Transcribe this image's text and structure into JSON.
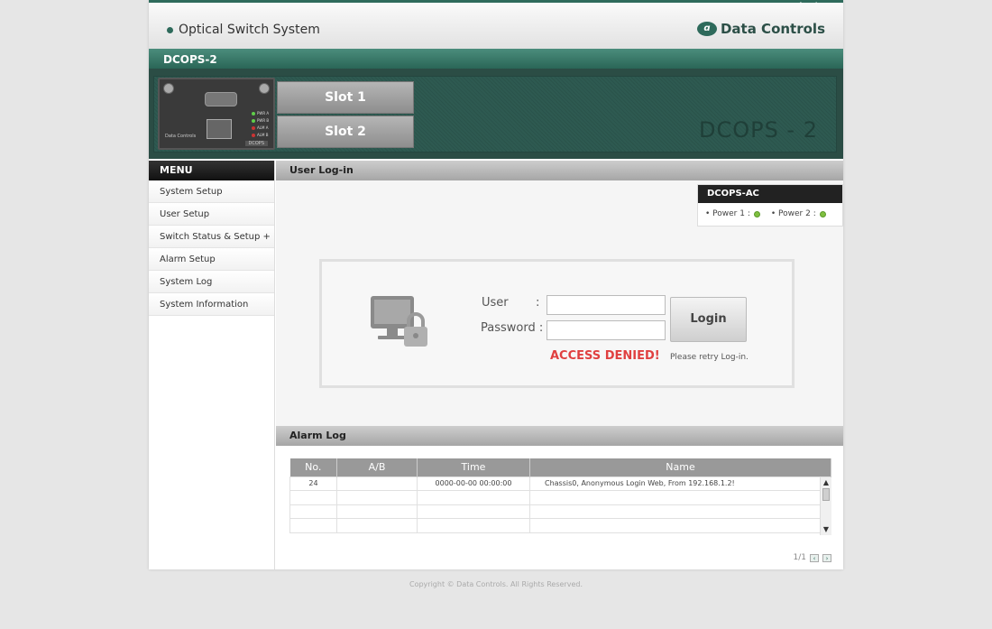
{
  "header": {
    "login_tab": "Log-in",
    "system_title": "Optical Switch System",
    "brand": "Data Controls",
    "model": "DCOPS-2"
  },
  "chassis": {
    "slot1": "Slot 1",
    "slot2": "Slot 2",
    "watermark": "DCOPS - 2",
    "module_brand": "Data Controls",
    "module_label": "DCOPS",
    "leds": [
      "PWR A",
      "PWR B",
      "ALM A",
      "ALM B"
    ]
  },
  "sidebar": {
    "title": "MENU",
    "items": [
      {
        "label": "System Setup"
      },
      {
        "label": "User Setup"
      },
      {
        "label": "Switch Status & Setup +"
      },
      {
        "label": "Alarm Setup"
      },
      {
        "label": "System Log"
      },
      {
        "label": "System Information"
      }
    ]
  },
  "login": {
    "section_title": "User Log-in",
    "user_label": "User",
    "password_label": "Password :",
    "colon": ":",
    "user_value": "",
    "password_value": "",
    "button": "Login",
    "error": "ACCESS DENIED!",
    "retry": "Please retry Log-in."
  },
  "power": {
    "title": "DCOPS-AC",
    "power1": "• Power 1 :",
    "power2": "• Power 2 :",
    "status_color": "#7fbf3f"
  },
  "alarm": {
    "section_title": "Alarm Log",
    "columns": [
      "No.",
      "A/B",
      "Time",
      "Name"
    ],
    "rows": [
      {
        "no": "24",
        "ab": "",
        "time": "0000-00-00  00:00:00",
        "name": "Chassis0, Anonymous Login Web, From 192.168.1.2!"
      }
    ],
    "page": "1/1"
  },
  "footer": {
    "copyright": "Copyright © Data Controls. All Rights Reserved."
  },
  "colors": {
    "accent": "#2e6a5b",
    "error": "#e04040"
  }
}
